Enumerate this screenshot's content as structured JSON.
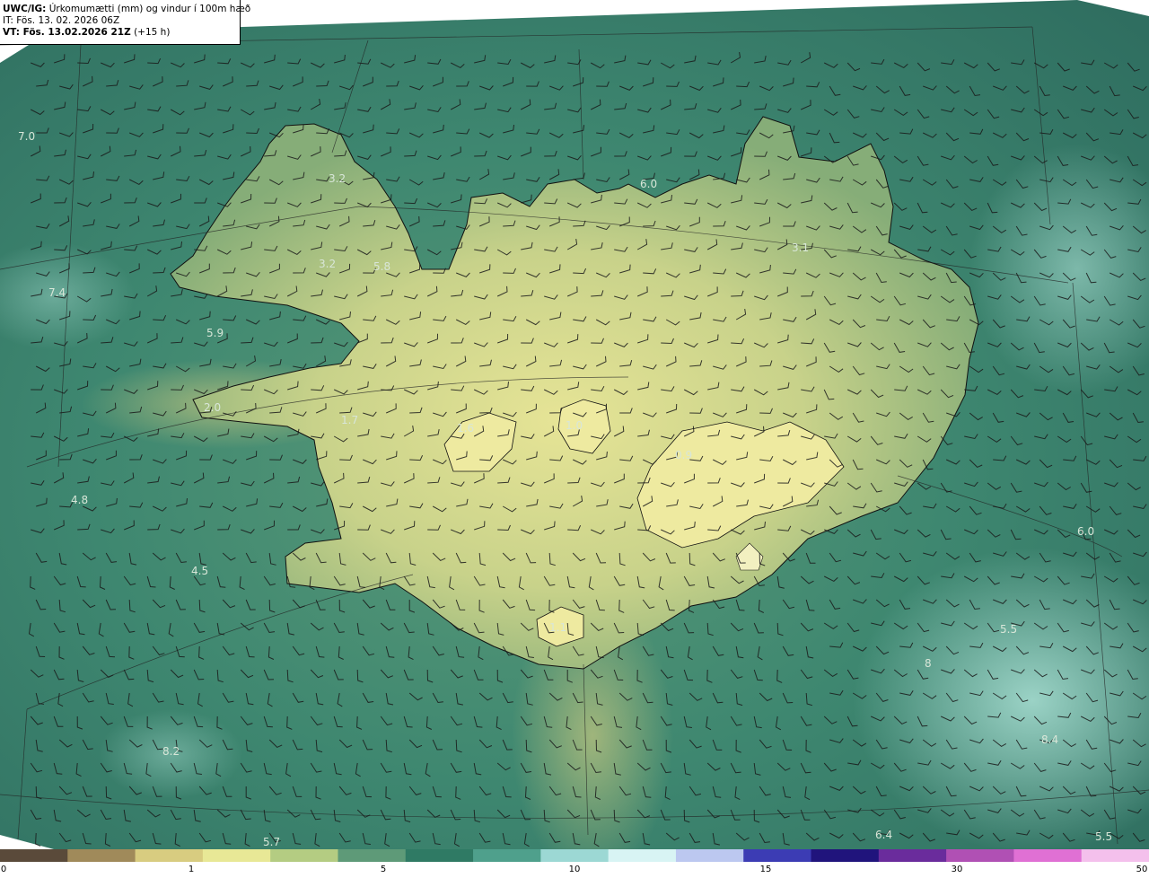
{
  "header": {
    "line1_bold": "UWC/IG:",
    "line1_text": " Úrkomumætti (mm) og vindur í 100m hæð",
    "line2_prefix": "IT:",
    "line2_text": " Fös. 13. 02. 2026 06Z",
    "line3_bold": "VT: Fös. 13.02.2026 21Z",
    "line3_text": " (+15 h)"
  },
  "colors": {
    "sea_dark": "#2f6e5e",
    "sea_mid": "#3f8c74",
    "land_mid": "#8fb07a",
    "land_light": "#d8dd8f",
    "cyan_high": "#9fd8cc"
  },
  "colorbar": {
    "ticks": [
      "0",
      "1",
      "5",
      "10",
      "15",
      "30",
      "50"
    ],
    "colors": [
      "#5a4a3a",
      "#a08a5a",
      "#d8cc80",
      "#e8e896",
      "#b4cc82",
      "#5e9a78",
      "#2f7a64",
      "#4fa08c",
      "#9cd8d4",
      "#d8f4f4",
      "#bcc8f0",
      "#3c3cb4",
      "#20147c",
      "#6a2c9c",
      "#b050b4",
      "#e070d4",
      "#f4c0ec"
    ]
  },
  "labels": [
    {
      "text": "7.0"
    },
    {
      "text": "3.2"
    },
    {
      "text": "6.0"
    },
    {
      "text": "3.1"
    },
    {
      "text": "3.2"
    },
    {
      "text": "5.8"
    },
    {
      "text": "7.4"
    },
    {
      "text": "5.9"
    },
    {
      "text": "2.0"
    },
    {
      "text": "1.7"
    },
    {
      "text": "1.6"
    },
    {
      "text": "1.0"
    },
    {
      "text": "0.9"
    },
    {
      "text": "4.8"
    },
    {
      "text": "4.5"
    },
    {
      "text": "1.1"
    },
    {
      "text": "6.0"
    },
    {
      "text": "5.5"
    },
    {
      "text": "8.2"
    },
    {
      "text": "5.7"
    },
    {
      "text": "6.4"
    },
    {
      "text": "5.5"
    },
    {
      "text": "8"
    },
    {
      "text": "8.4"
    }
  ],
  "map": {
    "graticule": "grid-lines",
    "wind": "wind-barbs"
  }
}
